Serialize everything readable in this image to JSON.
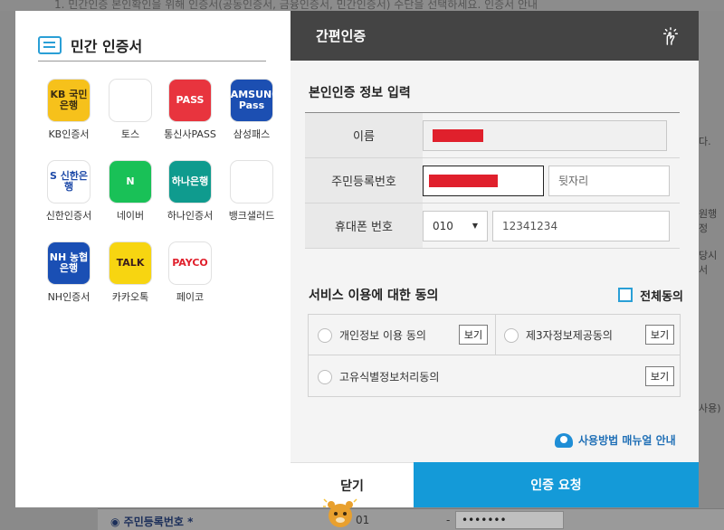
{
  "background": {
    "top_text": "1. 민간인증 본인확인을 위해 인증서(공동인증서, 금융인증서, 민간인증서) 수단을 선택하세요. 인증서 안내",
    "right_snips": [
      "다.",
      "원행정",
      "당시 서",
      "사용)"
    ],
    "bottom": {
      "label": "주민등록번호",
      "required_mark": "*",
      "value": "01",
      "dash": "-",
      "masked": "•••••••"
    }
  },
  "left_panel": {
    "title": "민간 인증서",
    "certs": [
      {
        "name": "KB인증서",
        "logo_text": "KB 국민은행",
        "color": "#f6c11b",
        "text_color": "#3b2d12"
      },
      {
        "name": "토스",
        "logo_text": "",
        "color": "#ffffff",
        "text_color": "#1b64da"
      },
      {
        "name": "통신사PASS",
        "logo_text": "PASS",
        "color": "#e8343e",
        "text_color": "#ffffff"
      },
      {
        "name": "삼성패스",
        "logo_text": "SAMSUNG Pass",
        "color": "#1c4fb2",
        "text_color": "#ffffff"
      },
      {
        "name": "신한인증서",
        "logo_text": "S 신한은행",
        "color": "#ffffff",
        "text_color": "#1e4aa8"
      },
      {
        "name": "네이버",
        "logo_text": "N",
        "color": "#19c157",
        "text_color": "#ffffff"
      },
      {
        "name": "하나인증서",
        "logo_text": "하나은행",
        "color": "#0f9b8e",
        "text_color": "#ffffff"
      },
      {
        "name": "뱅크샐러드",
        "logo_text": "",
        "color": "#ffffff",
        "text_color": "#26b4a8"
      },
      {
        "name": "NH인증서",
        "logo_text": "NH 농협은행",
        "color": "#1a4fb4",
        "text_color": "#ffffff"
      },
      {
        "name": "카카오톡",
        "logo_text": "TALK",
        "color": "#f7d511",
        "text_color": "#3a1d1d"
      },
      {
        "name": "페이코",
        "logo_text": "PAYCO",
        "color": "#ffffff",
        "text_color": "#e0202c"
      }
    ]
  },
  "right_panel": {
    "header_title": "간편인증",
    "section_title": "본인인증 정보 입력",
    "fields": {
      "name_label": "이름",
      "rrn_label": "주민등록번호",
      "rrn_back_placeholder": "뒷자리",
      "phone_label": "휴대폰 번호",
      "phone_prefix": "010",
      "phone_number": "12341234"
    },
    "agree": {
      "title": "서비스 이용에 대한 동의",
      "all_label": "전체동의",
      "items": [
        {
          "label": "개인정보 이용 동의",
          "view": "보기"
        },
        {
          "label": "제3자정보제공동의",
          "view": "보기"
        },
        {
          "label": "고유식별정보처리동의",
          "view": "보기"
        }
      ]
    },
    "manual_link": "사용방법 매뉴얼 안내",
    "close_button": "닫기",
    "auth_button": "인증 요청"
  }
}
